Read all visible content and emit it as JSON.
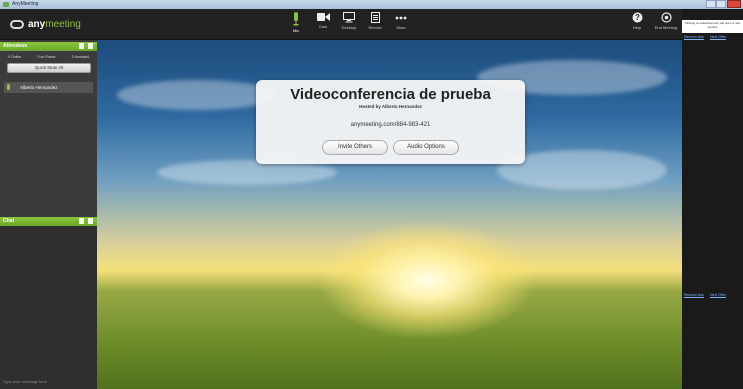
{
  "window": {
    "title": "AnyMeeting"
  },
  "brand": {
    "name_bold": "any",
    "name_rest": "meeting"
  },
  "toolbar": {
    "mic": "Mic",
    "cam": "Cam",
    "desktop": "Desktop",
    "record": "Record",
    "more": "More",
    "help": "Help",
    "end": "End Meeting"
  },
  "attendees": {
    "title": "Attendees",
    "status": [
      "0 Online",
      "0 on Phone",
      "0 Unmuted"
    ],
    "mute_all": "Quick Mute All",
    "people": [
      {
        "name": "Alberto Hernandez"
      }
    ]
  },
  "chat": {
    "title": "Chat",
    "placeholder": "Type your message here"
  },
  "meeting": {
    "title": "Videoconferencia de prueba",
    "host": "Hosted by Alberto Hernandez",
    "url": "anymeeting.com/884-983-421",
    "invite_btn": "Invite Others",
    "audio_btn": "Audio Options"
  },
  "ads": {
    "notice": "Clicking on advertisement will open a new window",
    "remove": "Remove Ads",
    "next": "Next Offer"
  },
  "colors": {
    "accent": "#8cc63f",
    "panel": "#3b3b3b",
    "bar": "#222222"
  }
}
